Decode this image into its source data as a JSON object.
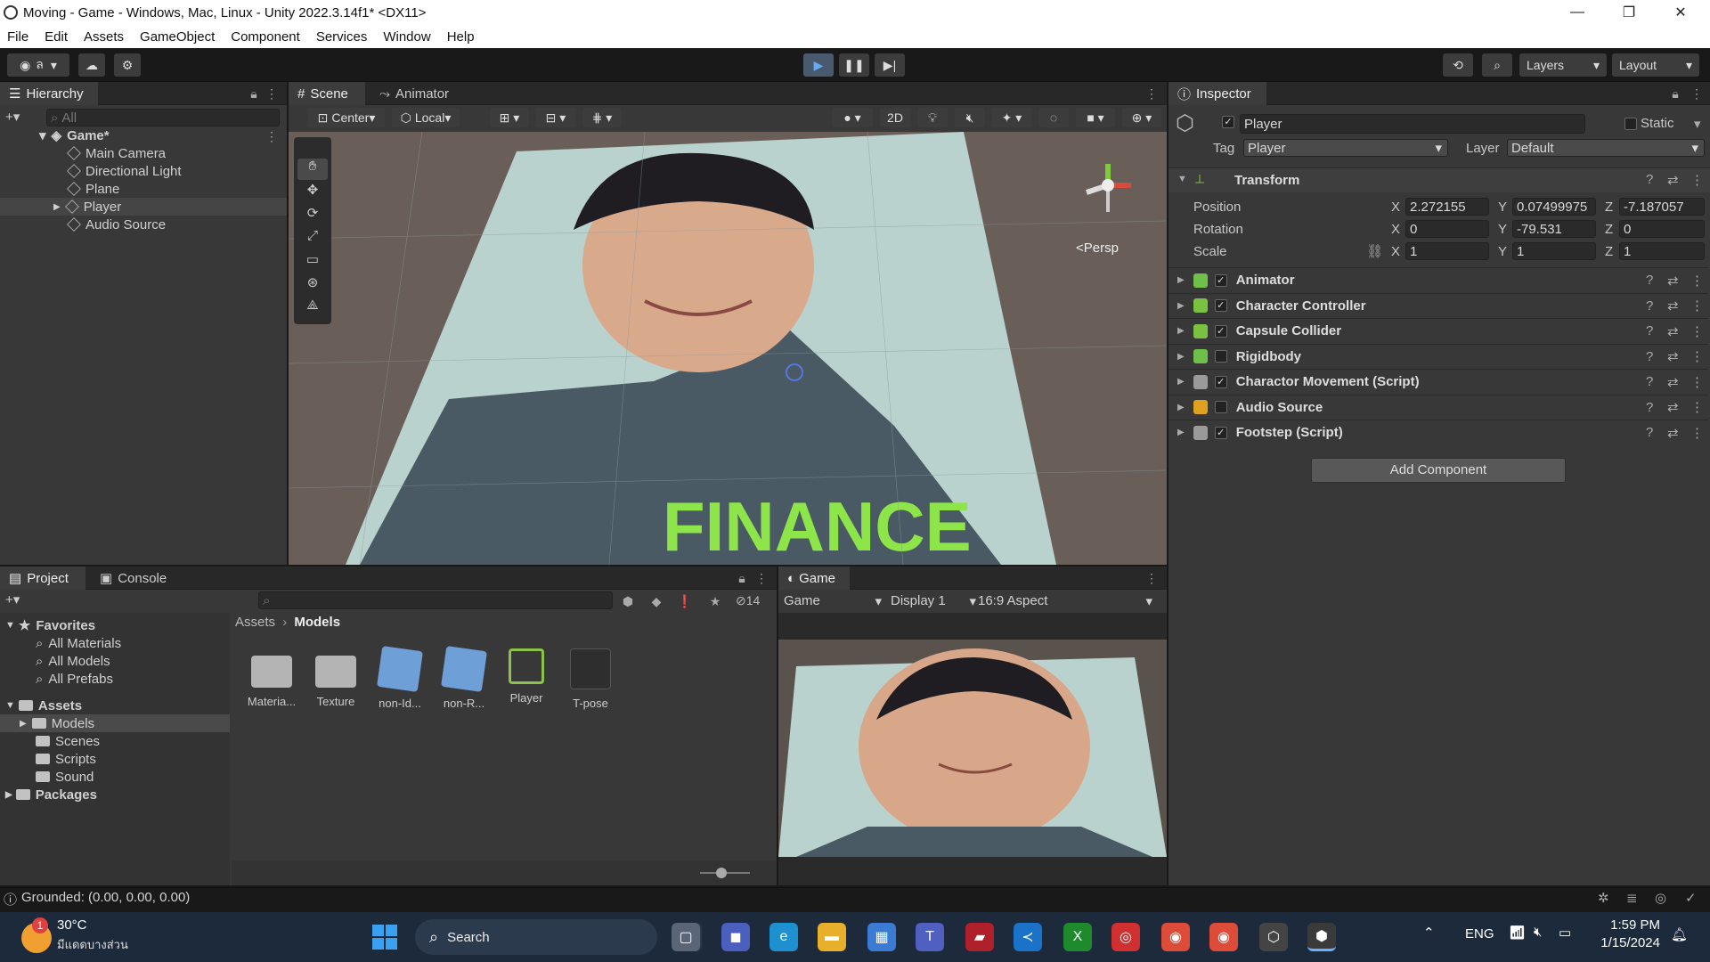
{
  "window": {
    "title": "Moving - Game - Windows, Mac, Linux - Unity 2022.3.14f1* <DX11>"
  },
  "menu": [
    "File",
    "Edit",
    "Assets",
    "GameObject",
    "Component",
    "Services",
    "Window",
    "Help"
  ],
  "toolbar": {
    "account_label": "ล",
    "layers": "Layers",
    "layout": "Layout"
  },
  "hierarchy": {
    "tab": "Hierarchy",
    "search_placeholder": "All",
    "scene": "Game*",
    "items": [
      "Main Camera",
      "Directional Light",
      "Plane",
      "Player",
      "Audio Source"
    ]
  },
  "scene": {
    "tabs": [
      "Scene",
      "Animator"
    ],
    "pivot": "Center",
    "space": "Local",
    "mode2d": "2D",
    "persp": "<Persp"
  },
  "inspector": {
    "tab": "Inspector",
    "object_name": "Player",
    "static_label": "Static",
    "tag_label": "Tag",
    "tag_value": "Player",
    "layer_label": "Layer",
    "layer_value": "Default",
    "transform": {
      "title": "Transform",
      "position_label": "Position",
      "rotation_label": "Rotation",
      "scale_label": "Scale",
      "position": {
        "x": "2.272155",
        "y": "0.07499975",
        "z": "-7.187057"
      },
      "rotation": {
        "x": "0",
        "y": "-79.531",
        "z": "0"
      },
      "scale": {
        "x": "1",
        "y": "1",
        "z": "1"
      }
    },
    "components": [
      {
        "name": "Animator",
        "checked": true,
        "color": "#6fbf4a"
      },
      {
        "name": "Character Controller",
        "checked": true,
        "color": "#7ac142"
      },
      {
        "name": "Capsule Collider",
        "checked": true,
        "color": "#7ac142"
      },
      {
        "name": "Rigidbody",
        "checked": false,
        "color": "#6fbf4a"
      },
      {
        "name": "Charactor Movement (Script)",
        "checked": true,
        "color": "#9a9a9a"
      },
      {
        "name": "Audio Source",
        "checked": false,
        "color": "#e0a020"
      },
      {
        "name": "Footstep (Script)",
        "checked": true,
        "color": "#9a9a9a"
      }
    ],
    "add_component": "Add Component"
  },
  "project": {
    "tabs": [
      "Project",
      "Console"
    ],
    "hidden_count": "14",
    "favorites_label": "Favorites",
    "favorites": [
      "All Materials",
      "All Models",
      "All Prefabs"
    ],
    "assets_label": "Assets",
    "asset_folders": [
      "Models",
      "Scenes",
      "Scripts",
      "Sound"
    ],
    "packages_label": "Packages",
    "breadcrumb": [
      "Assets",
      "Models"
    ],
    "files": [
      "Materia...",
      "Texture",
      "non-Id...",
      "non-R...",
      "Player",
      "T-pose"
    ]
  },
  "game": {
    "tab": "Game",
    "mode": "Game",
    "display": "Display 1",
    "aspect": "16:9 Aspect"
  },
  "statusbar": {
    "message": "Grounded: (0.00, 0.00, 0.00)"
  },
  "taskbar": {
    "weather_temp": "30°C",
    "weather_desc": "มีแดดบางส่วน",
    "search": "Search",
    "lang": "ENG",
    "time": "1:59 PM",
    "date": "1/15/2024",
    "badge": "1"
  }
}
